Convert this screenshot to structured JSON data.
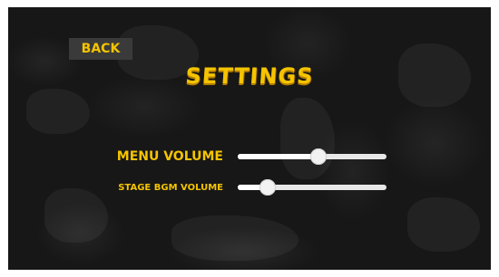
{
  "screen": {
    "back_label": "BACK",
    "title": "SETTINGS"
  },
  "settings": [
    {
      "id": "menu",
      "label": "MENU VOLUME",
      "value": 0.54
    },
    {
      "id": "bgm",
      "label": "STAGE BGM VOLUME",
      "value": 0.2
    }
  ],
  "colors": {
    "accent": "#f5c400",
    "background": "#171717",
    "slider": "#e8e8e8"
  }
}
